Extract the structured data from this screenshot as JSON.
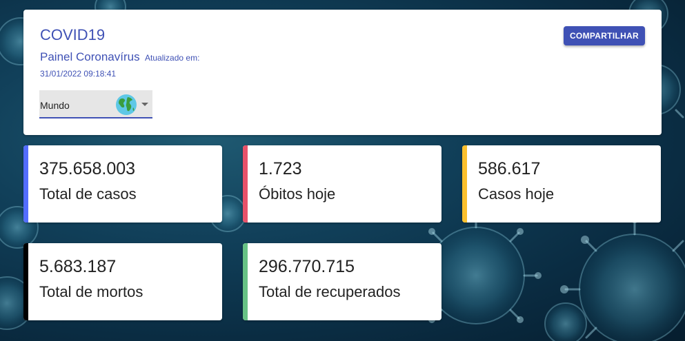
{
  "header": {
    "title": "COVID19",
    "subtitle": "Painel Coronavírus",
    "updated_label": "Atualizado em:",
    "updated_value": "31/01/2022 09:18:41",
    "share_label": "COMPARTILHAR",
    "region": {
      "selected": "Mundo",
      "icon": "globe-icon"
    }
  },
  "stats": [
    {
      "value": "375.658.003",
      "label": "Total de casos",
      "color": "#536dfe"
    },
    {
      "value": "1.723",
      "label": "Óbitos hoje",
      "color": "#e8526a"
    },
    {
      "value": "586.617",
      "label": "Casos hoje",
      "color": "#fbc02d"
    },
    {
      "value": "5.683.187",
      "label": "Total de mortos",
      "color": "#000000"
    },
    {
      "value": "296.770.715",
      "label": "Total de recuperados",
      "color": "#67c285"
    }
  ],
  "colors": {
    "primary": "#3f51b5"
  }
}
